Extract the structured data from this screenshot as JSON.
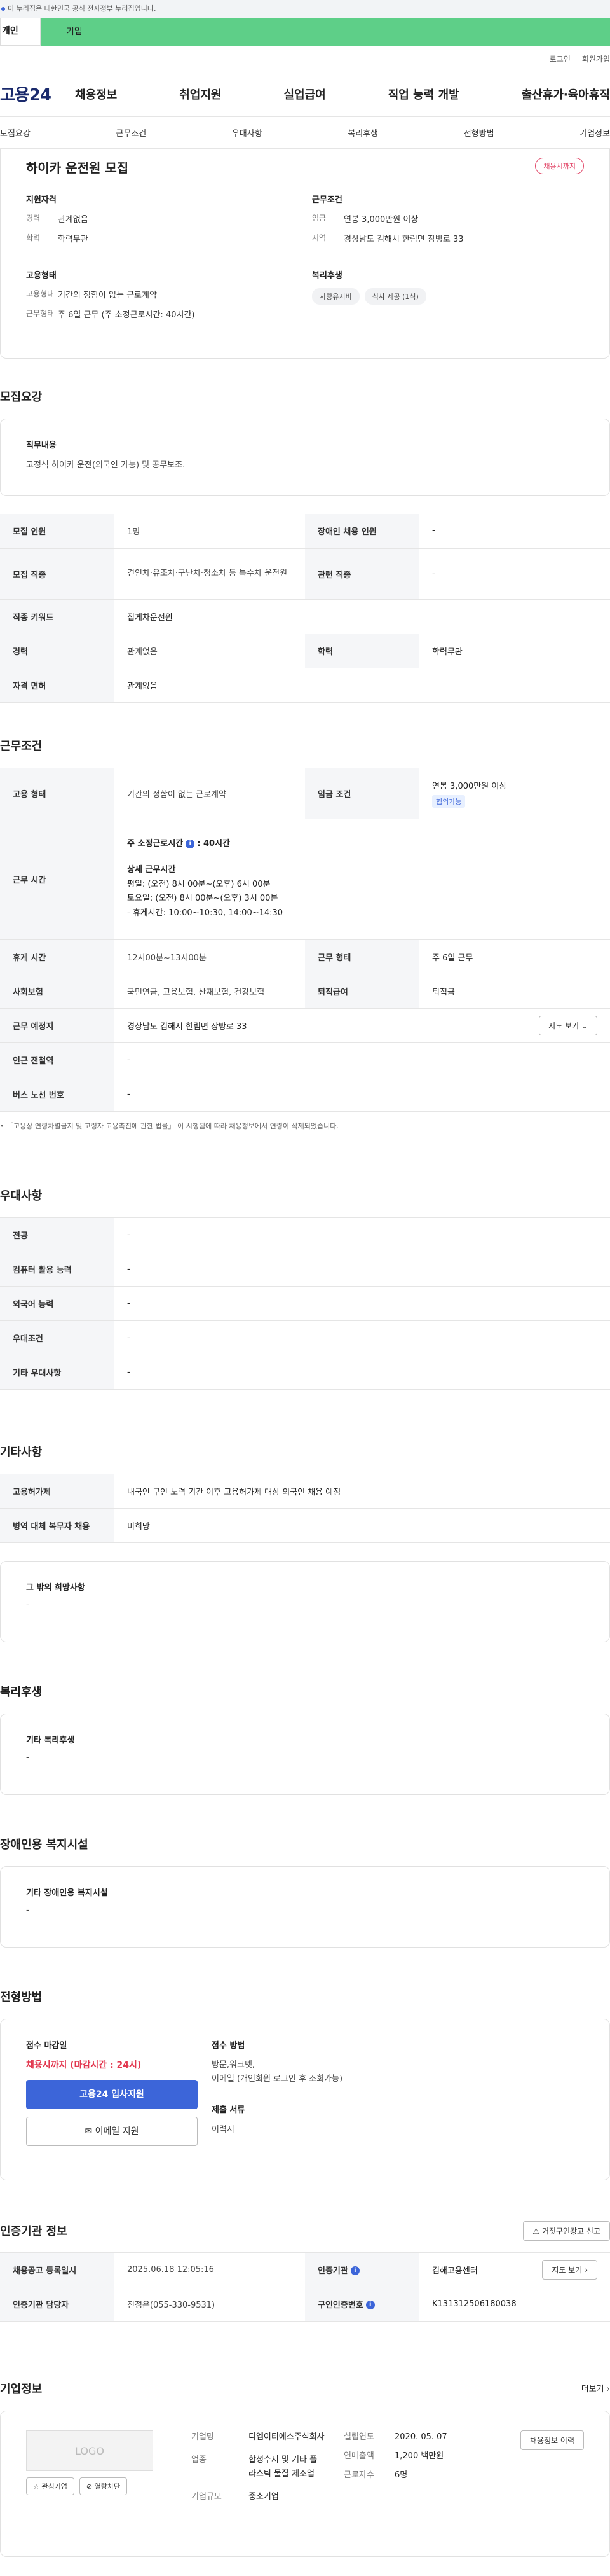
{
  "gov_bar": "이 누리집은 대한민국 공식 전자정부 누리집입니다.",
  "tabs": {
    "personal": "개인",
    "company": "기업"
  },
  "util": {
    "login": "로그인",
    "signup": "회원가입"
  },
  "gnb": {
    "logo": "고용24",
    "items": [
      "채용정보",
      "취업지원",
      "실업급여",
      "직업 능력 개발",
      "출산휴가·육아휴직"
    ]
  },
  "subnav": [
    "모집요강",
    "근무조건",
    "우대사항",
    "복리후생",
    "전형방법",
    "기업정보"
  ],
  "summary": {
    "title": "하이카 운전원 모집",
    "badge": "채용시까지",
    "qualification": {
      "title": "지원자격",
      "career_k": "경력",
      "career_v": "관계없음",
      "edu_k": "학력",
      "edu_v": "학력무관"
    },
    "conditions": {
      "title": "근무조건",
      "wage_k": "임금",
      "wage_v": "연봉 3,000만원 이상",
      "region_k": "지역",
      "region_v": "경상남도 김해시 한림면 장방로 33"
    },
    "employment": {
      "title": "고용형태",
      "type_k": "고용형태",
      "type_v": "기간의 정함이 없는 근로계약",
      "work_k": "근무형태",
      "work_v": "주 6일 근무 (주 소정근로시간: 40시간)"
    },
    "welfare": {
      "title": "복리후생",
      "chips": [
        "자량유지비",
        "식사 제공 (1식)"
      ]
    }
  },
  "recruit": {
    "title": "모집요강",
    "duty_title": "직무내용",
    "duty_text": "고정식 하이카 운전(외국인 가능) 및 공무보조.",
    "rows": {
      "headcount_k": "모집 인원",
      "headcount_v": "1명",
      "disabled_k": "장애인 채용 인원",
      "disabled_v": "-",
      "job_k": "모집 직종",
      "job_v": "견인차·유조차·구난차·청소차 등 특수차 운전원",
      "related_k": "관련 직종",
      "related_v": "-",
      "keyword_k": "직종 키워드",
      "keyword_v": "집게차운전원",
      "career_k": "경력",
      "career_v": "관계없음",
      "edu_k": "학력",
      "edu_v": "학력무관",
      "license_k": "자격 면허",
      "license_v": "관계없음"
    }
  },
  "work": {
    "title": "근무조건",
    "type_k": "고용 형태",
    "type_v": "기간의 정함이 없는 근로계약",
    "wage_k": "임금 조건",
    "wage_v": "연봉 3,000만원 이상",
    "wage_tag": "협의가능",
    "hours_k": "근무 시간",
    "hours_weekly": "주 소정근로시간",
    "hours_weekly_v": ": 40시간",
    "hours_detail_title": "상세 근무시간",
    "hours_lines": [
      "평일: (오전) 8시 00분~(오후) 6시 00분",
      "토요일: (오전) 8시 00분~(오후) 3시 00분",
      "- 휴게시간: 10:00~10:30, 14:00~14:30"
    ],
    "break_k": "휴게 시간",
    "break_v": "12시00분~13시00분",
    "form_k": "근무 형태",
    "form_v": "주 6일 근무",
    "insurance_k": "사회보험",
    "insurance_v": "국민연금, 고용보험, 산재보험, 건강보험",
    "severance_k": "퇴직급여",
    "severance_v": "퇴직금",
    "place_k": "근무 예정지",
    "place_v": "경상남도 김해시 한림면 장방로 33",
    "map_btn": "지도 보기",
    "subway_k": "인근 전철역",
    "subway_v": "-",
    "bus_k": "버스 노선 번호",
    "bus_v": "-",
    "note": "「고용상 연령차별금지 및 고령자 고용촉진에 관한 법률」 이 시행됨에 따라 채용정보에서 연령이 삭제되었습니다."
  },
  "preference": {
    "title": "우대사항",
    "rows": [
      {
        "k": "전공",
        "v": "-"
      },
      {
        "k": "컴퓨터 활용 능력",
        "v": "-"
      },
      {
        "k": "외국어 능력",
        "v": "-"
      },
      {
        "k": "우대조건",
        "v": "-"
      },
      {
        "k": "기타 우대사항",
        "v": "-"
      }
    ]
  },
  "etc": {
    "title": "기타사항",
    "rows": [
      {
        "k": "고용허가제",
        "v": "내국인 구인 노력 기간 이후 고용허가제 대상 외국인 채용 예정"
      },
      {
        "k": "병역 대체 복무자 채용",
        "v": "비희망"
      }
    ],
    "other_title": "그 밖의 희망사항",
    "other_v": "-"
  },
  "welfare": {
    "title": "복리후생",
    "sub": "기타 복리후생",
    "v": "-"
  },
  "disabled_fac": {
    "title": "장애인용 복지시설",
    "sub": "기타 장애인용 복지시설",
    "v": "-"
  },
  "selection": {
    "title": "전형방법",
    "deadline_t": "접수 마감일",
    "deadline_v": "채용시까지 (마감시간 : 24시)",
    "apply_btn": "고용24 입사지원",
    "email_btn": "이메일 지원",
    "method_t": "접수 방법",
    "method_v1": "방문,워크넷,",
    "method_v2": "이메일 (개인회원 로그인 후 조회가능)",
    "docs_t": "제출 서류",
    "docs_v": "이력서"
  },
  "cert": {
    "title": "인증기관 정보",
    "report_btn": "거짓구인광고 신고",
    "reg_k": "채용공고 등록일시",
    "reg_v": "2025.06.18 12:05:16",
    "org_k": "인증기관",
    "org_v": "김해고용센터",
    "map_btn": "지도 보기",
    "mgr_k": "인증기관 담당자",
    "mgr_v": "진정은(055-330-9531)",
    "no_k": "구인인증번호",
    "no_v": "K131312506180038"
  },
  "company": {
    "title": "기업정보",
    "more": "더보기",
    "logo": "LOGO",
    "fav_btn": "관심기업",
    "block_btn": "열람차단",
    "name_k": "기업명",
    "name_v": "디엠이티에스주식회사",
    "ind_k": "업종",
    "ind_v": "합성수지 및 기타 플라스틱 물질 제조업",
    "size_k": "기업규모",
    "size_v": "중소기업",
    "est_k": "설립연도",
    "est_v": "2020. 05. 07",
    "sales_k": "연매출액",
    "sales_v": "1,200 백만원",
    "emp_k": "근로자수",
    "emp_v": "6명",
    "history_btn": "채용정보 이력"
  }
}
